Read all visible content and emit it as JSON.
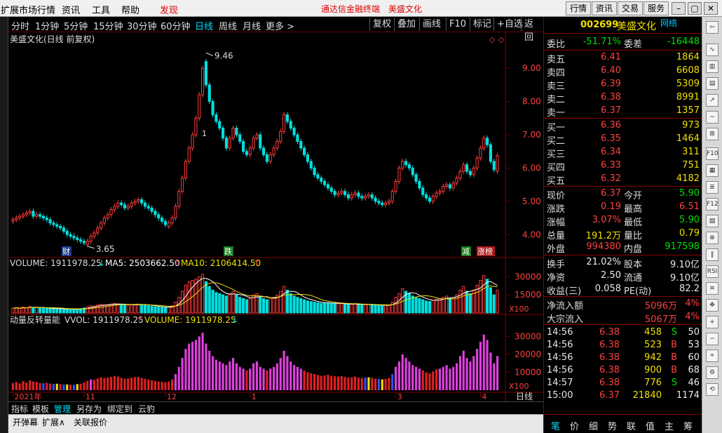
{
  "menu": {
    "items": [
      "扩展市场行情",
      "资讯",
      "工具",
      "帮助",
      "发现"
    ],
    "center": [
      "通达信金融终端",
      "美盛文化"
    ],
    "right_buttons": [
      "行情",
      "资讯",
      "交易",
      "服务"
    ]
  },
  "periods": [
    "分时",
    "1分钟",
    "5分钟",
    "15分钟",
    "30分钟",
    "60分钟",
    "日线",
    "周线",
    "月线",
    "更多 >"
  ],
  "active_period": "日线",
  "toolbar": [
    "复权",
    "叠加",
    "画线",
    "F10",
    "标记",
    "+自选",
    "返回"
  ],
  "chart_title": "美盛文化(日线 前复权)",
  "markers": {
    "high": "9.46",
    "low": "3.65",
    "tag_cai": "财",
    "tag_die": "跌",
    "tag_jian": "减",
    "tag_zhangbang": "涨榜",
    "mark_one": "1"
  },
  "volume_header": {
    "volume": "VOLUME: 1911978.25",
    "ma5": "MA5: 2503662.50",
    "ma10": "MA10: 2106414.50"
  },
  "indicator_header": {
    "name": "动量反转量能",
    "vvol": "VVOL: 1911978.25",
    "volume": "VOLUME: 1911978.25"
  },
  "x_axis": {
    "labels": [
      {
        "t": "2021年",
        "i": 0
      },
      {
        "t": "11",
        "i": 21
      },
      {
        "t": "12",
        "i": 45
      },
      {
        "t": "1",
        "i": 70
      },
      {
        "t": "3",
        "i": 113
      },
      {
        "t": "4",
        "i": 138
      }
    ],
    "period_label": "日线"
  },
  "bottom_tabs": [
    "指标",
    "模板",
    "管理",
    "另存为",
    "绑定到",
    "云豹"
  ],
  "status_bar": [
    "开弹幕",
    "扩展∧",
    "关联报价"
  ],
  "quote": {
    "code": "002699",
    "name": "美盛文化",
    "tag": "网络",
    "weibi_label": "委比",
    "weibi": "-51.71%",
    "weicha_label": "委差",
    "weicha": "-16448",
    "sell": [
      {
        "label": "卖五",
        "price": "6.41",
        "vol": "1864"
      },
      {
        "label": "卖四",
        "price": "6.40",
        "vol": "6608"
      },
      {
        "label": "卖三",
        "price": "6.39",
        "vol": "5309"
      },
      {
        "label": "卖二",
        "price": "6.38",
        "vol": "8991"
      },
      {
        "label": "卖一",
        "price": "6.37",
        "vol": "1357"
      }
    ],
    "buy": [
      {
        "label": "买一",
        "price": "6.36",
        "vol": "973"
      },
      {
        "label": "买二",
        "price": "6.35",
        "vol": "1464"
      },
      {
        "label": "买三",
        "price": "6.34",
        "vol": "311"
      },
      {
        "label": "买四",
        "price": "6.33",
        "vol": "751"
      },
      {
        "label": "买五",
        "price": "6.32",
        "vol": "4182"
      }
    ],
    "stats": [
      {
        "l1": "现价",
        "v1": "6.37",
        "l2": "今开",
        "v2": "5.90",
        "c1": "red",
        "c2": "green"
      },
      {
        "l1": "涨跌",
        "v1": "0.19",
        "l2": "最高",
        "v2": "6.51",
        "c1": "red",
        "c2": "red"
      },
      {
        "l1": "涨幅",
        "v1": "3.07%",
        "l2": "最低",
        "v2": "5.90",
        "c1": "red",
        "c2": "green"
      },
      {
        "l1": "总量",
        "v1": "191.2万",
        "l2": "量比",
        "v2": "0.79",
        "c1": "yel",
        "c2": "yel"
      },
      {
        "l1": "外盘",
        "v1": "994380",
        "l2": "内盘",
        "v2": "917598",
        "c1": "red",
        "c2": "green"
      }
    ],
    "stats2": [
      {
        "l1": "换手",
        "v1": "21.02%",
        "l2": "股本",
        "v2": "9.10亿"
      },
      {
        "l1": "净资",
        "v1": "2.50",
        "l2": "流通",
        "v2": "9.10亿"
      },
      {
        "l1": "收益(三)",
        "v1": "0.058",
        "l2": "PE(动)",
        "v2": "82.2"
      }
    ],
    "flow": [
      {
        "label": "净流入额",
        "val": "5096万",
        "pct": "4%"
      },
      {
        "label": "大宗流入",
        "val": "5067万",
        "pct": "4%"
      }
    ],
    "ticks": [
      {
        "time": "14:56",
        "price": "6.38",
        "vol": "458",
        "bs": "S",
        "n": "50"
      },
      {
        "time": "14:56",
        "price": "6.38",
        "vol": "523",
        "bs": "B",
        "n": "53"
      },
      {
        "time": "14:56",
        "price": "6.38",
        "vol": "942",
        "bs": "B",
        "n": "60"
      },
      {
        "time": "14:56",
        "price": "6.38",
        "vol": "900",
        "bs": "B",
        "n": "68"
      },
      {
        "time": "14:57",
        "price": "6.38",
        "vol": "776",
        "bs": "S",
        "n": "46"
      },
      {
        "time": "15:00",
        "price": "6.37",
        "vol": "21840",
        "bs": "",
        "n": "1174"
      }
    ],
    "tabs": [
      "笔",
      "价",
      "细",
      "势",
      "联",
      "值",
      "主",
      "筹"
    ]
  },
  "colors": {
    "up": "#ff3c3c",
    "down": "#00e0e0",
    "ma5": "#ffffff",
    "ma10": "#f0e000",
    "magenta": "#e040e0",
    "grid": "#800000"
  },
  "chart_data": [
    {
      "type": "candlestick",
      "title": "美盛文化(日线 前复权)",
      "y_ticks": [
        "9.00",
        "8.00",
        "7.00",
        "6.00",
        "5.00",
        "4.00"
      ],
      "ylim": [
        3.5,
        9.7
      ],
      "high": 9.46,
      "low": 3.65,
      "close": [
        4.45,
        4.5,
        4.55,
        4.6,
        4.65,
        4.7,
        4.55,
        4.6,
        4.55,
        4.5,
        4.45,
        4.35,
        4.3,
        4.25,
        4.2,
        4.1,
        4.0,
        3.95,
        3.9,
        3.85,
        3.8,
        3.75,
        3.8,
        3.95,
        4.05,
        4.2,
        4.35,
        4.5,
        4.6,
        4.75,
        4.85,
        4.95,
        4.9,
        4.8,
        4.85,
        4.95,
        5.0,
        5.05,
        4.95,
        4.85,
        4.8,
        4.7,
        4.6,
        4.5,
        4.4,
        4.3,
        4.35,
        4.5,
        4.85,
        5.3,
        5.7,
        6.2,
        6.6,
        7.0,
        7.5,
        8.2,
        9.0,
        8.5,
        8.0,
        7.6,
        7.4,
        7.2,
        6.9,
        6.6,
        6.9,
        7.2,
        7.0,
        6.8,
        6.5,
        6.4,
        6.6,
        6.9,
        7.0,
        6.6,
        6.4,
        6.2,
        6.4,
        6.6,
        6.8,
        7.1,
        7.6,
        7.4,
        7.2,
        7.0,
        6.8,
        6.6,
        6.4,
        6.2,
        6.0,
        5.8,
        5.7,
        5.6,
        5.5,
        5.4,
        5.3,
        5.2,
        5.25,
        5.3,
        5.2,
        5.1,
        5.2,
        5.25,
        5.15,
        5.1,
        5.15,
        5.2,
        5.1,
        5.0,
        4.95,
        4.9,
        4.95,
        5.0,
        5.3,
        5.6,
        6.0,
        6.2,
        6.1,
        6.0,
        5.8,
        5.6,
        5.4,
        5.2,
        5.1,
        5.0,
        5.15,
        5.25,
        5.3,
        5.45,
        5.5,
        5.4,
        5.55,
        5.7,
        5.9,
        6.1,
        5.9,
        5.8,
        6.0,
        6.3,
        6.6,
        6.9,
        6.7,
        6.2,
        5.95,
        6.37
      ],
      "open": [
        4.4,
        4.45,
        4.5,
        4.55,
        4.6,
        4.65,
        4.7,
        4.55,
        4.6,
        4.55,
        4.5,
        4.45,
        4.35,
        4.3,
        4.25,
        4.2,
        4.1,
        4.0,
        3.95,
        3.9,
        3.85,
        3.8,
        3.7,
        3.8,
        3.95,
        4.05,
        4.2,
        4.35,
        4.5,
        4.6,
        4.75,
        4.85,
        4.95,
        4.9,
        4.8,
        4.85,
        4.95,
        5.0,
        5.05,
        4.95,
        4.85,
        4.8,
        4.7,
        4.6,
        4.5,
        4.4,
        4.25,
        4.35,
        4.5,
        4.85,
        5.3,
        5.7,
        6.2,
        6.6,
        7.0,
        7.5,
        8.2,
        9.2,
        8.5,
        8.0,
        7.6,
        7.4,
        7.2,
        6.9,
        6.6,
        6.9,
        7.2,
        7.0,
        6.8,
        6.5,
        6.4,
        6.6,
        6.9,
        7.0,
        6.6,
        6.4,
        6.2,
        6.4,
        6.6,
        6.8,
        7.1,
        7.6,
        7.4,
        7.2,
        7.0,
        6.8,
        6.6,
        6.4,
        6.2,
        6.0,
        5.8,
        5.7,
        5.6,
        5.5,
        5.4,
        5.3,
        5.2,
        5.25,
        5.3,
        5.2,
        5.1,
        5.2,
        5.25,
        5.15,
        5.1,
        5.15,
        5.2,
        5.1,
        5.0,
        4.95,
        4.9,
        4.95,
        5.0,
        5.3,
        5.6,
        6.0,
        6.2,
        6.1,
        6.0,
        5.8,
        5.6,
        5.4,
        5.2,
        5.1,
        5.0,
        5.15,
        5.25,
        5.3,
        5.45,
        5.5,
        5.4,
        5.55,
        5.7,
        5.9,
        6.1,
        5.9,
        5.8,
        6.0,
        6.3,
        6.6,
        6.9,
        6.7,
        6.2,
        5.9
      ]
    },
    {
      "type": "bar",
      "title": "VOLUME",
      "y_ticks": [
        "30000",
        "15000"
      ],
      "unit": "X100",
      "ylim": [
        0,
        36000
      ],
      "values": [
        4000,
        4500,
        3800,
        5000,
        4200,
        5500,
        4800,
        4600,
        4000,
        3900,
        4100,
        3700,
        3500,
        3600,
        3400,
        3300,
        3200,
        3100,
        3000,
        3400,
        3600,
        4200,
        5200,
        6000,
        5800,
        6600,
        7200,
        6800,
        7000,
        7400,
        8000,
        7600,
        6900,
        6400,
        6600,
        7000,
        7200,
        7400,
        6800,
        6400,
        6000,
        5600,
        5200,
        4800,
        4600,
        4400,
        4800,
        6000,
        9000,
        13000,
        18000,
        23000,
        26000,
        27000,
        28000,
        30000,
        32000,
        26000,
        22000,
        19000,
        17000,
        16000,
        15000,
        14000,
        16000,
        18000,
        15000,
        13000,
        12000,
        11000,
        12000,
        15000,
        16000,
        13000,
        12000,
        11000,
        12000,
        13000,
        15000,
        18000,
        22000,
        19000,
        16000,
        14000,
        13000,
        12000,
        11000,
        10000,
        9500,
        9000,
        8500,
        8000,
        8200,
        8600,
        8000,
        7800,
        7600,
        7800,
        7400,
        7000,
        7200,
        7600,
        7000,
        6800,
        7000,
        7200,
        6800,
        6400,
        6200,
        6000,
        6400,
        6800,
        9000,
        13000,
        16000,
        20000,
        18000,
        16000,
        14000,
        13000,
        12000,
        11000,
        10000,
        9500,
        10500,
        11500,
        12000,
        13000,
        14000,
        12000,
        13000,
        15000,
        19000,
        22000,
        18000,
        16000,
        19000,
        23000,
        27000,
        31000,
        28000,
        21000,
        15000,
        19000
      ],
      "ma5_value": 2503662.5,
      "ma10_value": 2106414.5
    },
    {
      "type": "bar",
      "title": "动量反转量能",
      "y_ticks": [
        "30000",
        "20000",
        "10000"
      ],
      "unit": "X100",
      "ylim": [
        0,
        36000
      ]
    }
  ]
}
